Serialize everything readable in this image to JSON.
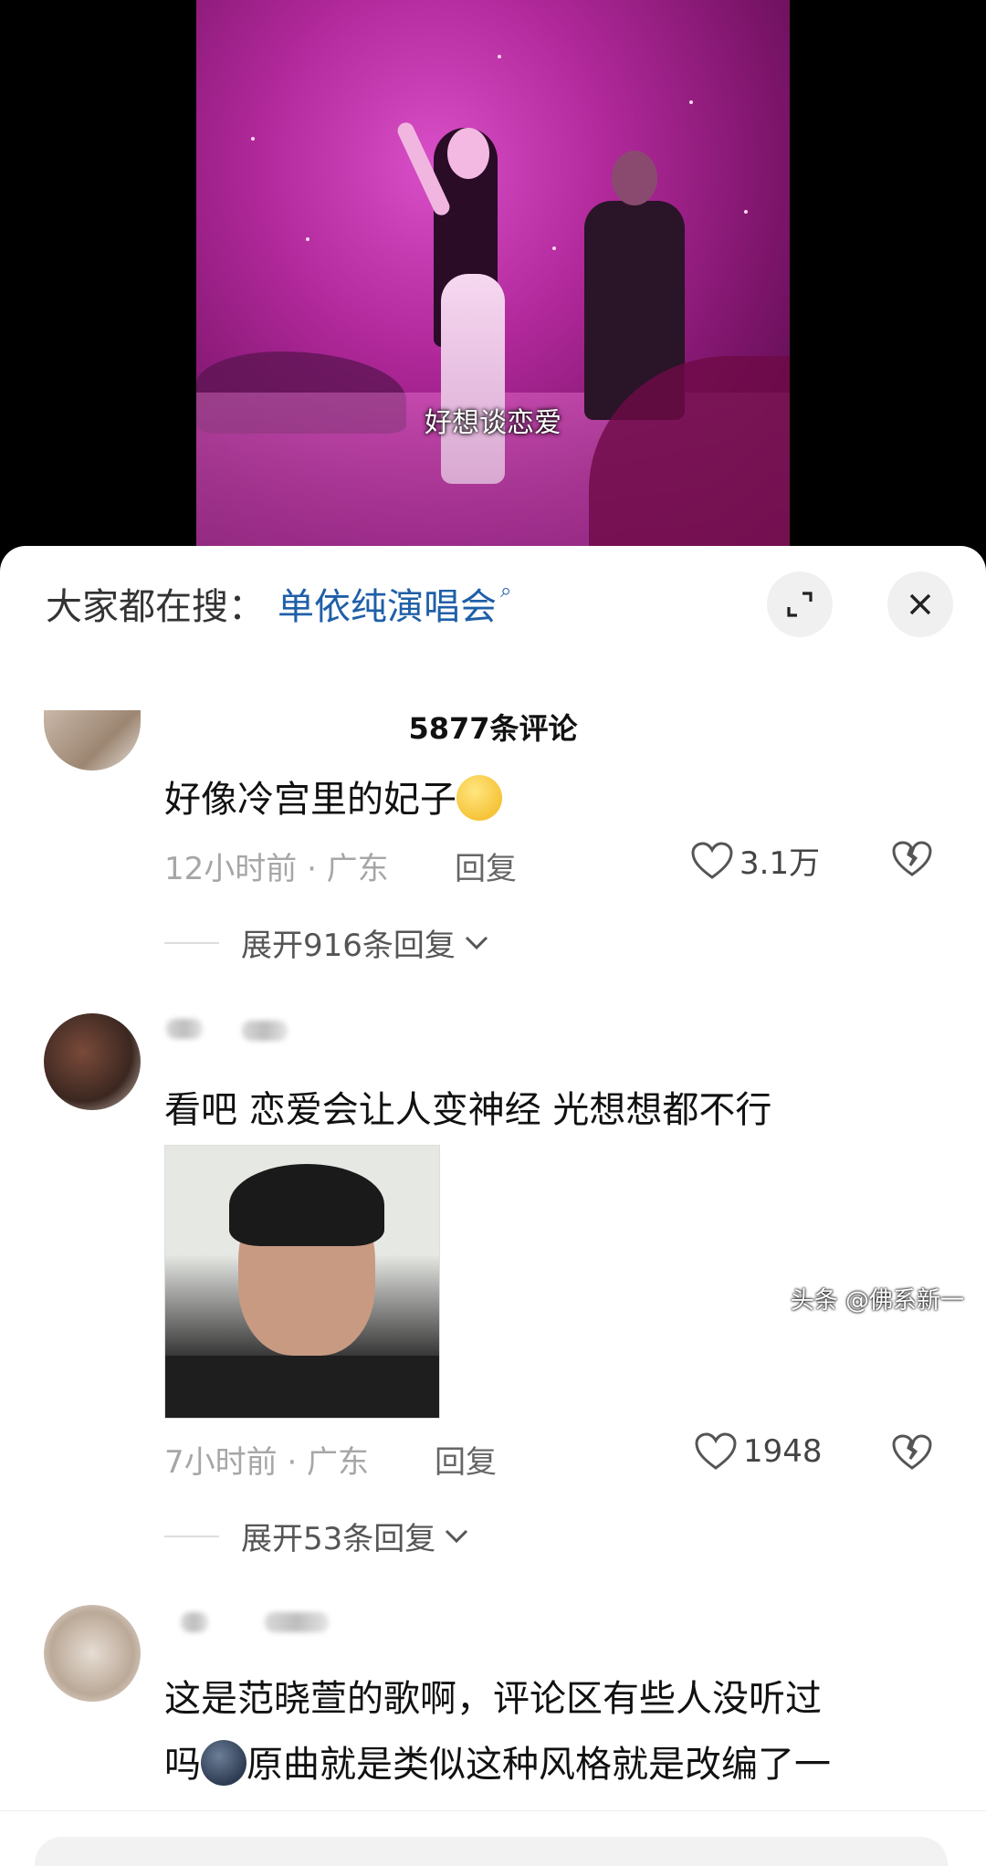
{
  "video": {
    "subtitle": "好想谈恋爱"
  },
  "search_bar": {
    "label": "大家都在搜：",
    "term": "单依纯演唱会"
  },
  "comments_header": {
    "count_label": "5877条评论"
  },
  "comments": [
    {
      "text": "好像冷宫里的妃子",
      "emoji": "dizzy-face-emoji",
      "time_location": "12小时前 · 广东",
      "reply_label": "回复",
      "likes": "3.1万",
      "expand_label": "展开916条回复"
    },
    {
      "text": "看吧 恋爱会让人变神经 光想想都不行",
      "time_location": "7小时前 · 广东",
      "reply_label": "回复",
      "likes": "1948",
      "expand_label": "展开53条回复"
    },
    {
      "text_line1": "这是范晓萱的歌啊，评论区有些人没听过",
      "text_line2_pre": "吗",
      "emoji": "new-moon-face-emoji",
      "text_line2_post": "原曲就是类似这种风格就是改编了一"
    }
  ],
  "watermark": "头条 @佛系新一",
  "colors": {
    "search_term": "#1f5fa8",
    "video_tint": "#b0289a"
  }
}
